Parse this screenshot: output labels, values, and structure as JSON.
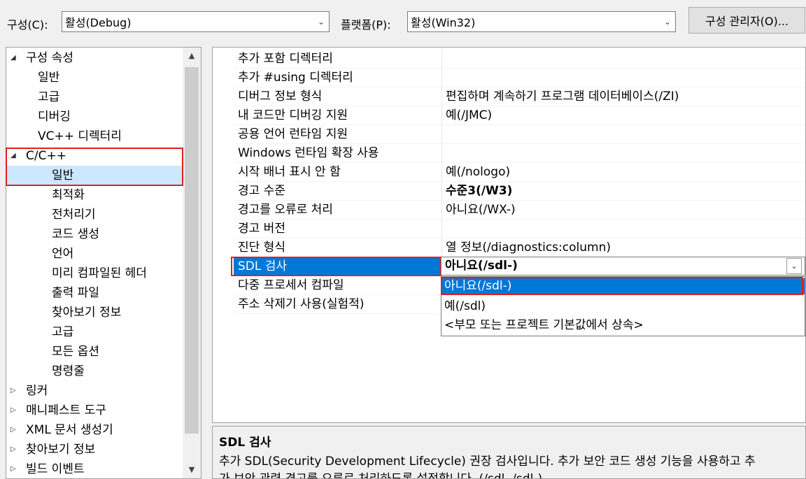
{
  "toolbar": {
    "config_label": "구성(C):",
    "config_value": "활성(Debug)",
    "platform_label": "플랫폼(P):",
    "platform_value": "활성(Win32)",
    "config_manager_button": "구성 관리자(O)..."
  },
  "tree": {
    "items": [
      {
        "label": "구성 속성",
        "expander": "expanded"
      },
      {
        "label": "일반"
      },
      {
        "label": "고급"
      },
      {
        "label": "디버깅"
      },
      {
        "label": "VC++ 디렉터리"
      },
      {
        "label": "C/C++",
        "expander": "expanded"
      },
      {
        "label": "일반",
        "selected": true
      },
      {
        "label": "최적화"
      },
      {
        "label": "전처리기"
      },
      {
        "label": "코드 생성"
      },
      {
        "label": "언어"
      },
      {
        "label": "미리 컴파일된 헤더"
      },
      {
        "label": "출력 파일"
      },
      {
        "label": "찾아보기 정보"
      },
      {
        "label": "고급"
      },
      {
        "label": "모든 옵션"
      },
      {
        "label": "명령줄"
      },
      {
        "label": "링커",
        "expander": "collapsed"
      },
      {
        "label": "매니페스트 도구",
        "expander": "collapsed"
      },
      {
        "label": "XML 문서 생성기",
        "expander": "collapsed"
      },
      {
        "label": "찾아보기 정보",
        "expander": "collapsed"
      },
      {
        "label": "빌드 이벤트",
        "expander": "collapsed"
      }
    ]
  },
  "properties": [
    {
      "name": "추가 포함 디렉터리",
      "value": ""
    },
    {
      "name": "추가 #using 디렉터리",
      "value": ""
    },
    {
      "name": "디버그 정보 형식",
      "value": "편집하며 계속하기 프로그램 데이터베이스(/ZI)"
    },
    {
      "name": "내 코드만 디버깅 지원",
      "value": "예(/JMC)"
    },
    {
      "name": "공용 언어 런타임 지원",
      "value": ""
    },
    {
      "name": "Windows 런타임 확장 사용",
      "value": ""
    },
    {
      "name": "시작 배너 표시 안 함",
      "value": "예(/nologo)"
    },
    {
      "name": "경고 수준",
      "value": "수준3(/W3)",
      "bold": true
    },
    {
      "name": "경고를 오류로 처리",
      "value": "아니요(/WX-)"
    },
    {
      "name": "경고 버전",
      "value": ""
    },
    {
      "name": "진단 형식",
      "value": "열 정보(/diagnostics:column)"
    },
    {
      "name": "SDL 검사",
      "value": "아니요(/sdl-)",
      "bold": true,
      "selected": true
    },
    {
      "name": "다중 프로세서 컴파일",
      "value": ""
    },
    {
      "name": "주소 삭제기 사용(실험적)",
      "value": ""
    }
  ],
  "dropdown": {
    "current": "아니요(/sdl-)",
    "options": [
      {
        "label": "아니요(/sdl-)",
        "highlighted": true
      },
      {
        "label": "예(/sdl)"
      },
      {
        "label": "<부모 또는 프로젝트 기본값에서 상속>"
      }
    ]
  },
  "description": {
    "title": "SDL 검사",
    "line1": "추가 SDL(Security Development Lifecycle) 권장 검사입니다. 추가 보안 코드 생성 기능을 사용하고 추",
    "line2": "가 보안 관련 경고를 오류로 처리하도록 설정합니다. (/sdl, /sdl-)"
  },
  "colors": {
    "selection_blue": "#0078d7",
    "tree_selection": "#cce8ff",
    "annotation_red": "#e02020"
  },
  "icons": {
    "expanded": "triangle-down-icon",
    "collapsed": "triangle-right-icon",
    "dropdown": "chevron-down-icon",
    "scroll_up": "scroll-up-icon",
    "scroll_down": "scroll-down-icon"
  }
}
